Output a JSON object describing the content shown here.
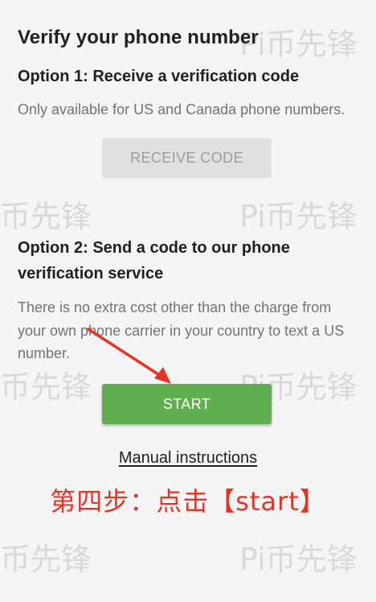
{
  "page": {
    "title": "Verify your phone number"
  },
  "option1": {
    "heading": "Option 1: Receive a verification code",
    "description": "Only available for US and Canada phone numbers.",
    "button_label": "RECEIVE CODE"
  },
  "option2": {
    "heading": "Option 2: Send a code to our phone verification service",
    "description": "There is no extra cost other than the charge from your own phone carrier in your country to text a US number.",
    "button_label": "START"
  },
  "manual_link": {
    "label": "Manual instructions"
  },
  "annotation": {
    "text": "第四步：点击【start】",
    "color": "#e63323"
  },
  "watermark": {
    "full": "Pi币先锋",
    "partial": "币先锋"
  },
  "colors": {
    "start_button": "#5faf51",
    "receive_button_disabled": "#e0e0e0",
    "arrow": "#e63323"
  }
}
